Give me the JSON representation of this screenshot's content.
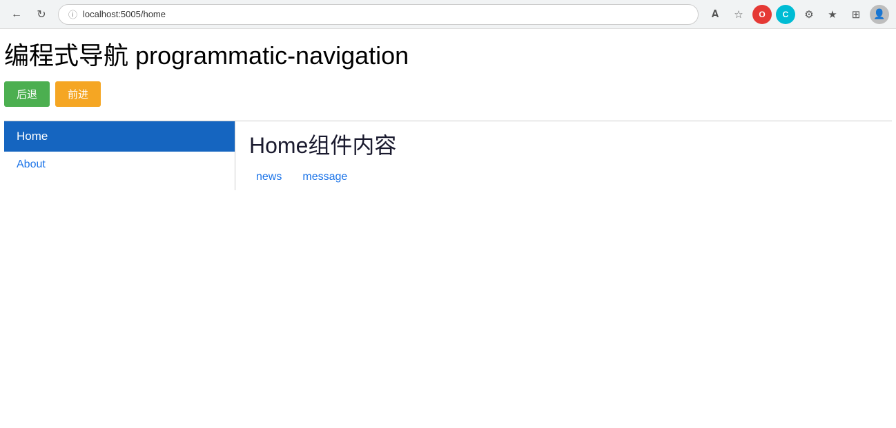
{
  "browser": {
    "url": "localhost:5005/home",
    "back_icon": "←",
    "refresh_icon": "↻",
    "info_icon": "ⓘ",
    "aa_icon": "A",
    "star_icon": "☆",
    "opera_icon": "O",
    "c_icon": "C",
    "gear_icon": "⚙",
    "fav_icon": "★",
    "tab_icon": "⊞",
    "avatar_icon": "👤"
  },
  "page": {
    "title": "编程式导航 programmatic-navigation",
    "btn_back_label": "后退",
    "btn_forward_label": "前进"
  },
  "sidebar": {
    "items": [
      {
        "label": "Home",
        "active": true
      },
      {
        "label": "About",
        "active": false
      }
    ]
  },
  "content": {
    "home_title": "Home组件内容",
    "sub_links": [
      {
        "label": "news"
      },
      {
        "label": "message"
      }
    ]
  }
}
